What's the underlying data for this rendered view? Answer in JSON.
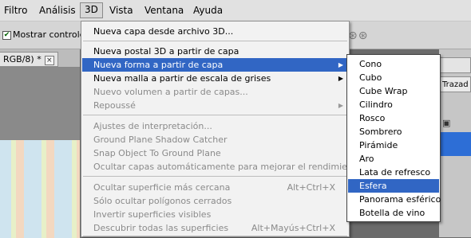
{
  "menubar": {
    "items": [
      "Filtro",
      "Análisis",
      "3D",
      "Vista",
      "Ventana",
      "Ayuda"
    ],
    "active": "3D"
  },
  "options_bar": {
    "show_controls_label": "Mostrar controles t",
    "show_controls_checked": true
  },
  "document_tab": {
    "title": "RGB/8) *",
    "close": "×"
  },
  "right_panel": {
    "tab1": "",
    "tab2": "Trazad"
  },
  "menu_3d": {
    "items": [
      {
        "label": "Nueva capa desde archivo 3D...",
        "enabled": true
      },
      {
        "label": "Nueva postal 3D a partir de capa",
        "enabled": true
      },
      {
        "label": "Nueva forma a partir de capa",
        "enabled": true,
        "submenu": true,
        "highlighted": true
      },
      {
        "label": "Nueva malla a partir de escala de grises",
        "enabled": true,
        "submenu": true
      },
      {
        "label": "Nuevo volumen a partir de capas...",
        "enabled": false
      },
      {
        "label": "Repoussé",
        "enabled": false,
        "submenu": true
      },
      {
        "label": "Ajustes de interpretación...",
        "enabled": false
      },
      {
        "label": "Ground Plane Shadow Catcher",
        "enabled": false
      },
      {
        "label": "Snap Object To Ground Plane",
        "enabled": false
      },
      {
        "label": "Ocultar capas automáticamente para mejorar el rendimiento",
        "enabled": false
      },
      {
        "label": "Ocultar superficie más cercana",
        "enabled": false,
        "shortcut": "Alt+Ctrl+X"
      },
      {
        "label": "Sólo ocultar polígonos cerrados",
        "enabled": false
      },
      {
        "label": "Invertir superficies visibles",
        "enabled": false
      },
      {
        "label": "Descubrir todas las superficies",
        "enabled": false,
        "shortcut": "Alt+Mayús+Ctrl+X"
      }
    ]
  },
  "submenu_shapes": {
    "items": [
      "Cono",
      "Cubo",
      "Cube Wrap",
      "Cilindro",
      "Rosco",
      "Sombrero",
      "Pirámide",
      "Aro",
      "Lata de refresco",
      "Esfera",
      "Panorama esférico",
      "Botella de vino"
    ],
    "highlighted": "Esfera"
  },
  "colors": {
    "highlight": "#3166c4",
    "menu_bg": "#f2f2f2",
    "disabled_text": "#8a8a8a"
  }
}
